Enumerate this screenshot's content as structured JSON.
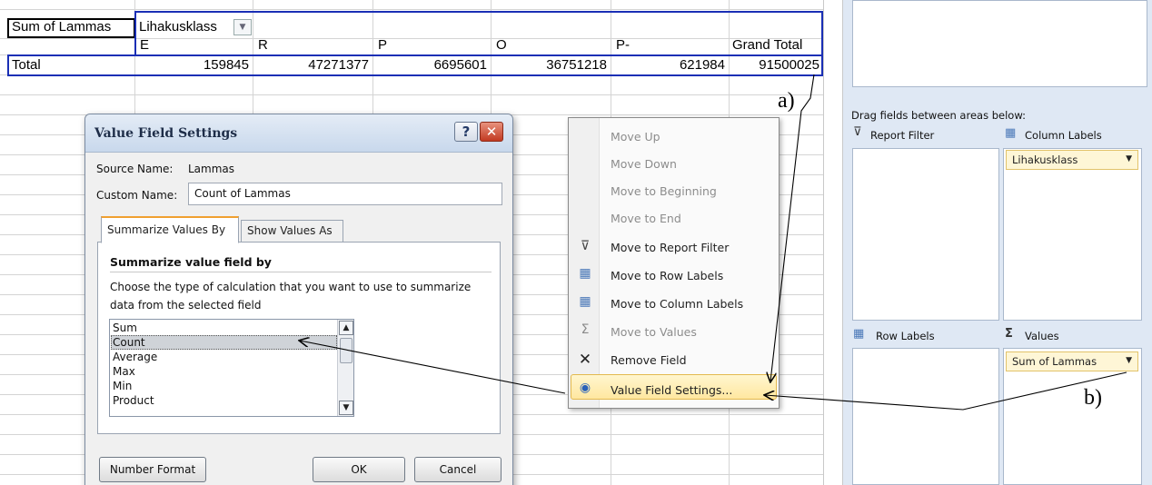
{
  "pivot": {
    "data_field": "Sum of Lammas",
    "column_field": "Lihakusklass",
    "column_headers": [
      "E",
      "R",
      "P",
      "O",
      "P-"
    ],
    "grand_total_label": "Grand Total",
    "row_label": "Total",
    "values": [
      "159845",
      "47271377",
      "6695601",
      "36751218",
      "621984",
      "91500025"
    ]
  },
  "dialog": {
    "title": "Value Field Settings",
    "help_glyph": "?",
    "close_glyph": "✕",
    "source_name_label": "Source Name:",
    "source_name_value": "Lammas",
    "custom_name_label": "Custom Name:",
    "custom_name_value": "Count of Lammas",
    "tabs": [
      "Summarize Values By",
      "Show Values As"
    ],
    "section_title": "Summarize value field by",
    "description_line1": "Choose the type of calculation that you want to use to summarize",
    "description_line2": "data from the selected field",
    "functions": [
      "Sum",
      "Count",
      "Average",
      "Max",
      "Min",
      "Product"
    ],
    "selected_function": "Count",
    "number_format_button": "Number Format",
    "ok_button": "OK",
    "cancel_button": "Cancel"
  },
  "context_menu": {
    "items": [
      {
        "label": "Move Up",
        "enabled": false,
        "icon": ""
      },
      {
        "label": "Move Down",
        "enabled": false,
        "icon": ""
      },
      {
        "label": "Move to Beginning",
        "enabled": false,
        "icon": ""
      },
      {
        "label": "Move to End",
        "enabled": false,
        "icon": ""
      },
      {
        "label": "Move to Report Filter",
        "enabled": true,
        "icon": "filter-icon"
      },
      {
        "label": "Move to Row Labels",
        "enabled": true,
        "icon": "row-labels-icon"
      },
      {
        "label": "Move to Column Labels",
        "enabled": true,
        "icon": "column-labels-icon"
      },
      {
        "label": "Move to Values",
        "enabled": false,
        "icon": "sigma-icon"
      },
      {
        "label": "Remove Field",
        "enabled": true,
        "icon": "remove-icon"
      },
      {
        "label": "Value Field Settings...",
        "enabled": true,
        "icon": "field-settings-icon",
        "highlighted": true
      }
    ]
  },
  "field_list": {
    "drag_hint": "Drag fields between areas below:",
    "report_filter": "Report Filter",
    "column_labels": "Column Labels",
    "column_field_chip": "Lihakusklass",
    "row_labels": "Row Labels",
    "values": "Values",
    "values_chip": "Sum of Lammas"
  },
  "annotations": {
    "a": "a)",
    "b": "b)"
  }
}
